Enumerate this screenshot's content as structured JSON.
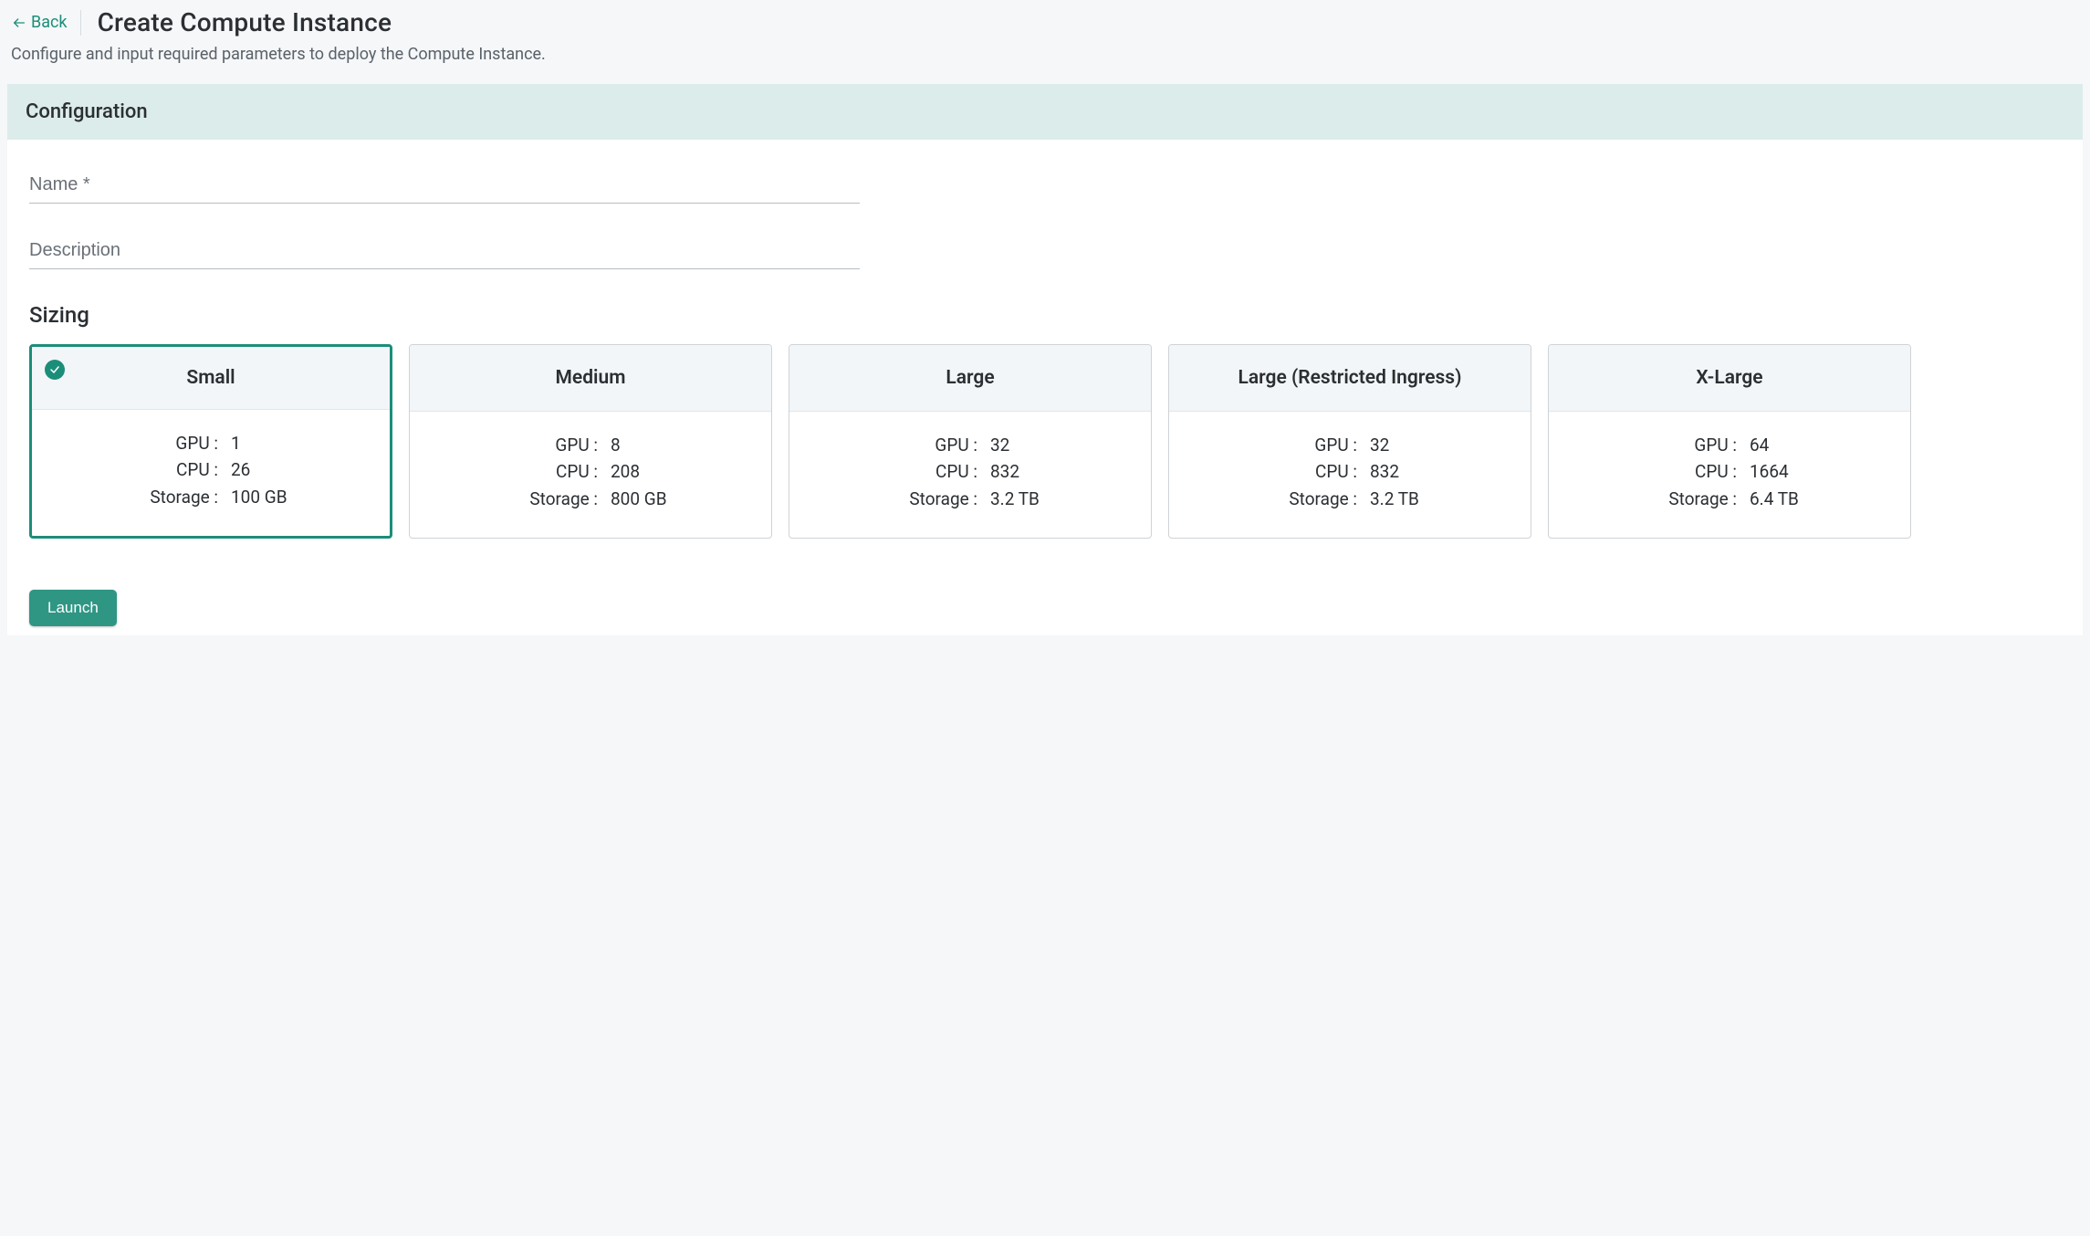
{
  "header": {
    "back_label": "Back",
    "title": "Create Compute Instance",
    "subtitle": "Configure and input required parameters to deploy the Compute Instance."
  },
  "panel": {
    "title": "Configuration"
  },
  "form": {
    "name": {
      "placeholder": "Name *",
      "value": ""
    },
    "description": {
      "placeholder": "Description",
      "value": ""
    }
  },
  "sizing": {
    "title": "Sizing",
    "labels": {
      "gpu": "GPU :",
      "cpu": "CPU :",
      "storage": "Storage :"
    },
    "options": [
      {
        "id": "small",
        "name": "Small",
        "gpu": "1",
        "cpu": "26",
        "storage": "100 GB",
        "selected": true
      },
      {
        "id": "medium",
        "name": "Medium",
        "gpu": "8",
        "cpu": "208",
        "storage": "800 GB",
        "selected": false
      },
      {
        "id": "large",
        "name": "Large",
        "gpu": "32",
        "cpu": "832",
        "storage": "3.2 TB",
        "selected": false
      },
      {
        "id": "large-ri",
        "name": "Large (Restricted Ingress)",
        "gpu": "32",
        "cpu": "832",
        "storage": "3.2 TB",
        "selected": false
      },
      {
        "id": "xlarge",
        "name": "X-Large",
        "gpu": "64",
        "cpu": "1664",
        "storage": "6.4 TB",
        "selected": false
      }
    ]
  },
  "footer": {
    "launch_label": "Launch"
  }
}
